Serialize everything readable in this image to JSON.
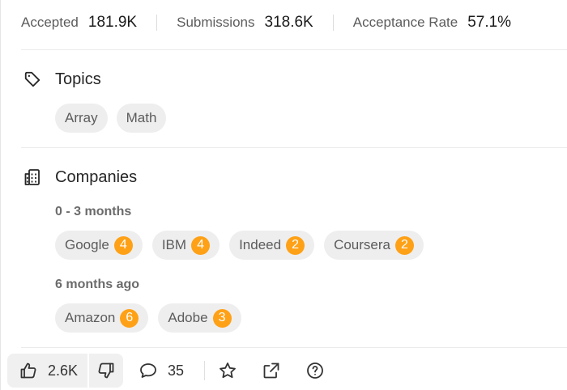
{
  "stats": {
    "accepted_label": "Accepted",
    "accepted_value": "181.9K",
    "submissions_label": "Submissions",
    "submissions_value": "318.6K",
    "acceptance_label": "Acceptance Rate",
    "acceptance_value": "57.1%"
  },
  "topics": {
    "title": "Topics",
    "icon": "tag-icon",
    "items": [
      "Array",
      "Math"
    ]
  },
  "companies": {
    "title": "Companies",
    "icon": "building-icon",
    "groups": [
      {
        "period": "0 - 3 months",
        "items": [
          {
            "name": "Google",
            "count": "4"
          },
          {
            "name": "IBM",
            "count": "4"
          },
          {
            "name": "Indeed",
            "count": "2"
          },
          {
            "name": "Coursera",
            "count": "2"
          }
        ]
      },
      {
        "period": "6 months ago",
        "items": [
          {
            "name": "Amazon",
            "count": "6"
          },
          {
            "name": "Adobe",
            "count": "3"
          }
        ]
      }
    ]
  },
  "toolbar": {
    "likes": "2.6K",
    "comments": "35",
    "icons": [
      "thumbs-up-icon",
      "thumbs-down-icon",
      "comment-icon",
      "star-icon",
      "share-icon",
      "help-icon"
    ]
  },
  "colors": {
    "badge": "#ffa116",
    "chip_bg": "#eeeeee",
    "button_bg": "#f0f0f0"
  }
}
